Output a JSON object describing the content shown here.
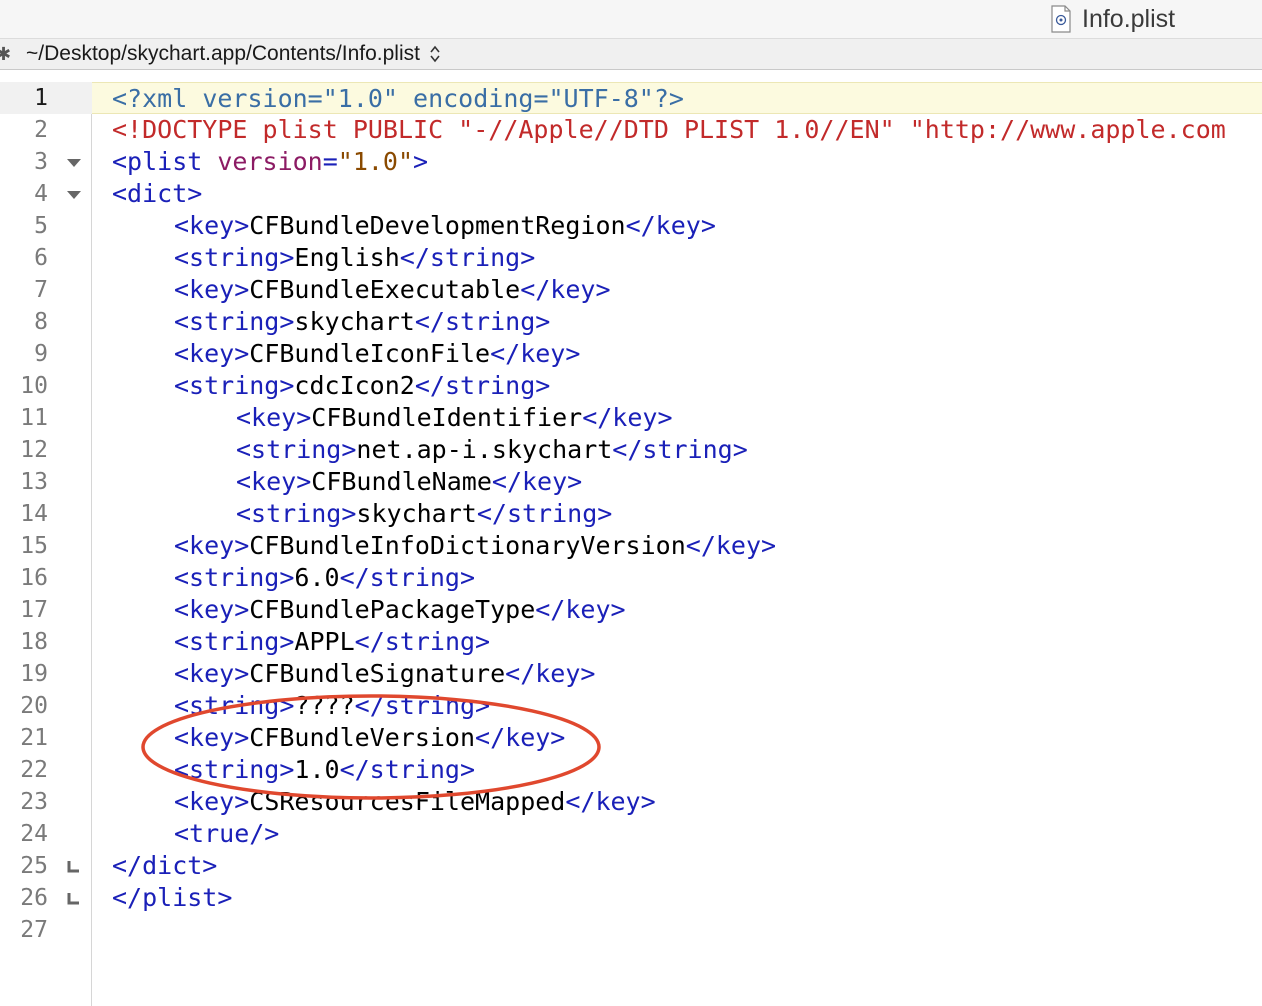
{
  "tab": {
    "title": "Info.plist",
    "icon": "plist-file-icon"
  },
  "pathbar": {
    "path": "~/Desktop/skychart.app/Contents/Info.plist"
  },
  "editor": {
    "current_line": 1,
    "lines": [
      {
        "num": "1",
        "fold": "",
        "indent": 0,
        "segments": [
          {
            "t": "<?xml ",
            "c": "pi"
          },
          {
            "t": "version",
            "c": "pi"
          },
          {
            "t": "=\"1.0\" ",
            "c": "pi"
          },
          {
            "t": "encoding",
            "c": "pi"
          },
          {
            "t": "=\"UTF-8\"?>",
            "c": "pi"
          }
        ]
      },
      {
        "num": "2",
        "fold": "",
        "indent": 0,
        "segments": [
          {
            "t": "<!DOCTYPE plist PUBLIC \"-//Apple//DTD PLIST 1.0//EN\" \"http://www.apple.com",
            "c": "red"
          }
        ]
      },
      {
        "num": "3",
        "fold": "open",
        "indent": 0,
        "segments": [
          {
            "t": "<plist ",
            "c": "blue"
          },
          {
            "t": "version",
            "c": "plum"
          },
          {
            "t": "=",
            "c": "blue"
          },
          {
            "t": "\"1.0\"",
            "c": "brown"
          },
          {
            "t": ">",
            "c": "blue"
          }
        ]
      },
      {
        "num": "4",
        "fold": "open",
        "indent": 0,
        "segments": [
          {
            "t": "<dict>",
            "c": "blue"
          }
        ]
      },
      {
        "num": "5",
        "fold": "",
        "indent": 1,
        "segments": [
          {
            "t": "<key>",
            "c": "blue"
          },
          {
            "t": "CFBundleDevelopmentRegion",
            "c": "txt"
          },
          {
            "t": "</key>",
            "c": "blue"
          }
        ]
      },
      {
        "num": "6",
        "fold": "",
        "indent": 1,
        "segments": [
          {
            "t": "<string>",
            "c": "blue"
          },
          {
            "t": "English",
            "c": "txt"
          },
          {
            "t": "</string>",
            "c": "blue"
          }
        ]
      },
      {
        "num": "7",
        "fold": "",
        "indent": 1,
        "segments": [
          {
            "t": "<key>",
            "c": "blue"
          },
          {
            "t": "CFBundleExecutable",
            "c": "txt"
          },
          {
            "t": "</key>",
            "c": "blue"
          }
        ]
      },
      {
        "num": "8",
        "fold": "",
        "indent": 1,
        "segments": [
          {
            "t": "<string>",
            "c": "blue"
          },
          {
            "t": "skychart",
            "c": "txt"
          },
          {
            "t": "</string>",
            "c": "blue"
          }
        ]
      },
      {
        "num": "9",
        "fold": "",
        "indent": 1,
        "segments": [
          {
            "t": "<key>",
            "c": "blue"
          },
          {
            "t": "CFBundleIconFile",
            "c": "txt"
          },
          {
            "t": "</key>",
            "c": "blue"
          }
        ]
      },
      {
        "num": "10",
        "fold": "",
        "indent": 1,
        "segments": [
          {
            "t": "<string>",
            "c": "blue"
          },
          {
            "t": "cdcIcon2",
            "c": "txt"
          },
          {
            "t": "</string>",
            "c": "blue"
          }
        ]
      },
      {
        "num": "11",
        "fold": "",
        "indent": 2,
        "segments": [
          {
            "t": "<key>",
            "c": "blue"
          },
          {
            "t": "CFBundleIdentifier",
            "c": "txt"
          },
          {
            "t": "</key>",
            "c": "blue"
          }
        ]
      },
      {
        "num": "12",
        "fold": "",
        "indent": 2,
        "segments": [
          {
            "t": "<string>",
            "c": "blue"
          },
          {
            "t": "net.ap-i.skychart",
            "c": "txt"
          },
          {
            "t": "</string>",
            "c": "blue"
          }
        ]
      },
      {
        "num": "13",
        "fold": "",
        "indent": 2,
        "segments": [
          {
            "t": "<key>",
            "c": "blue"
          },
          {
            "t": "CFBundleName",
            "c": "txt"
          },
          {
            "t": "</key>",
            "c": "blue"
          }
        ]
      },
      {
        "num": "14",
        "fold": "",
        "indent": 2,
        "segments": [
          {
            "t": "<string>",
            "c": "blue"
          },
          {
            "t": "skychart",
            "c": "txt"
          },
          {
            "t": "</string>",
            "c": "blue"
          }
        ]
      },
      {
        "num": "15",
        "fold": "",
        "indent": 1,
        "segments": [
          {
            "t": "<key>",
            "c": "blue"
          },
          {
            "t": "CFBundleInfoDictionaryVersion",
            "c": "txt"
          },
          {
            "t": "</key>",
            "c": "blue"
          }
        ]
      },
      {
        "num": "16",
        "fold": "",
        "indent": 1,
        "segments": [
          {
            "t": "<string>",
            "c": "blue"
          },
          {
            "t": "6.0",
            "c": "txt"
          },
          {
            "t": "</string>",
            "c": "blue"
          }
        ]
      },
      {
        "num": "17",
        "fold": "",
        "indent": 1,
        "segments": [
          {
            "t": "<key>",
            "c": "blue"
          },
          {
            "t": "CFBundlePackageType",
            "c": "txt"
          },
          {
            "t": "</key>",
            "c": "blue"
          }
        ]
      },
      {
        "num": "18",
        "fold": "",
        "indent": 1,
        "segments": [
          {
            "t": "<string>",
            "c": "blue"
          },
          {
            "t": "APPL",
            "c": "txt"
          },
          {
            "t": "</string>",
            "c": "blue"
          }
        ]
      },
      {
        "num": "19",
        "fold": "",
        "indent": 1,
        "segments": [
          {
            "t": "<key>",
            "c": "blue"
          },
          {
            "t": "CFBundleSignature",
            "c": "txt"
          },
          {
            "t": "</key>",
            "c": "blue"
          }
        ]
      },
      {
        "num": "20",
        "fold": "",
        "indent": 1,
        "segments": [
          {
            "t": "<string>",
            "c": "blue"
          },
          {
            "t": "????",
            "c": "txt"
          },
          {
            "t": "</string>",
            "c": "blue"
          }
        ]
      },
      {
        "num": "21",
        "fold": "",
        "indent": 1,
        "segments": [
          {
            "t": "<key>",
            "c": "blue"
          },
          {
            "t": "CFBundleVersion",
            "c": "txt"
          },
          {
            "t": "</key>",
            "c": "blue"
          }
        ]
      },
      {
        "num": "22",
        "fold": "",
        "indent": 1,
        "segments": [
          {
            "t": "<string>",
            "c": "blue"
          },
          {
            "t": "1.0",
            "c": "txt"
          },
          {
            "t": "</string>",
            "c": "blue"
          }
        ]
      },
      {
        "num": "23",
        "fold": "",
        "indent": 1,
        "segments": [
          {
            "t": "<key>",
            "c": "blue"
          },
          {
            "t": "CSResourcesFileMapped",
            "c": "txt"
          },
          {
            "t": "</key>",
            "c": "blue"
          }
        ]
      },
      {
        "num": "24",
        "fold": "",
        "indent": 1,
        "segments": [
          {
            "t": "<true/>",
            "c": "blue"
          }
        ]
      },
      {
        "num": "25",
        "fold": "close",
        "indent": 0,
        "segments": [
          {
            "t": "</dict>",
            "c": "blue"
          }
        ]
      },
      {
        "num": "26",
        "fold": "close",
        "indent": 0,
        "segments": [
          {
            "t": "</plist>",
            "c": "blue"
          }
        ]
      },
      {
        "num": "27",
        "fold": "",
        "indent": 0,
        "segments": []
      }
    ]
  },
  "annotation": {
    "shape": "ellipse",
    "color": "#e0482e",
    "highlighted_lines": [
      "21",
      "22"
    ]
  },
  "colors": {
    "tag": "#1a20b8",
    "doctype": "#c22a2a",
    "attribute_name": "#8c1b64",
    "attribute_value": "#8a4a00",
    "processing_instruction": "#3a6ea5",
    "text": "#000000",
    "current_line_bg": "#fcfadf"
  }
}
